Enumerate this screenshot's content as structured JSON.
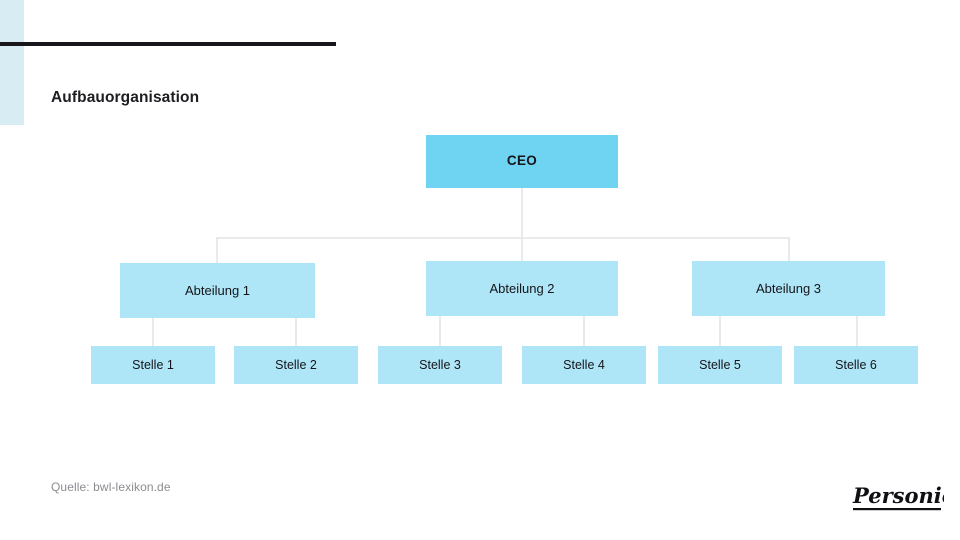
{
  "slide": {
    "title": "Aufbauorganisation",
    "source_note": "Quelle: bwl-lexikon.de",
    "brand": "Personio",
    "colors": {
      "accent_strip": "#d8ecf4",
      "top_rule": "#17171b",
      "node_root": "#6fd3f2",
      "node_child": "#afe6f7",
      "connector": "#e3e5e6",
      "title_text": "#1d1d22",
      "source_text": "#8c8c92"
    }
  },
  "chart_data": {
    "type": "diagram",
    "diagram_kind": "org-chart",
    "title": "Aufbauorganisation",
    "orientation": "top-down",
    "levels": 3,
    "nodes": [
      {
        "id": "ceo",
        "label": "CEO",
        "level": 0,
        "parent": null
      },
      {
        "id": "dept1",
        "label": "Abteilung 1",
        "level": 1,
        "parent": "ceo"
      },
      {
        "id": "dept2",
        "label": "Abteilung 2",
        "level": 1,
        "parent": "ceo"
      },
      {
        "id": "dept3",
        "label": "Abteilung 3",
        "level": 1,
        "parent": "ceo"
      },
      {
        "id": "role1",
        "label": "Stelle 1",
        "level": 2,
        "parent": "dept1"
      },
      {
        "id": "role2",
        "label": "Stelle 2",
        "level": 2,
        "parent": "dept1"
      },
      {
        "id": "role3",
        "label": "Stelle 3",
        "level": 2,
        "parent": "dept2"
      },
      {
        "id": "role4",
        "label": "Stelle 4",
        "level": 2,
        "parent": "dept2"
      },
      {
        "id": "role5",
        "label": "Stelle 5",
        "level": 2,
        "parent": "dept3"
      },
      {
        "id": "role6",
        "label": "Stelle 6",
        "level": 2,
        "parent": "dept3"
      }
    ],
    "edges": [
      {
        "from": "ceo",
        "to": "dept1"
      },
      {
        "from": "ceo",
        "to": "dept2"
      },
      {
        "from": "ceo",
        "to": "dept3"
      },
      {
        "from": "dept1",
        "to": "role1"
      },
      {
        "from": "dept1",
        "to": "role2"
      },
      {
        "from": "dept2",
        "to": "role3"
      },
      {
        "from": "dept2",
        "to": "role4"
      },
      {
        "from": "dept3",
        "to": "role5"
      },
      {
        "from": "dept3",
        "to": "role6"
      }
    ]
  },
  "chart": {
    "root": {
      "label": "CEO"
    },
    "departments": [
      {
        "label": "Abteilung 1"
      },
      {
        "label": "Abteilung 2"
      },
      {
        "label": "Abteilung 3"
      }
    ],
    "roles": [
      {
        "label": "Stelle 1"
      },
      {
        "label": "Stelle 2"
      },
      {
        "label": "Stelle 3"
      },
      {
        "label": "Stelle 4"
      },
      {
        "label": "Stelle 5"
      },
      {
        "label": "Stelle 6"
      }
    ]
  }
}
